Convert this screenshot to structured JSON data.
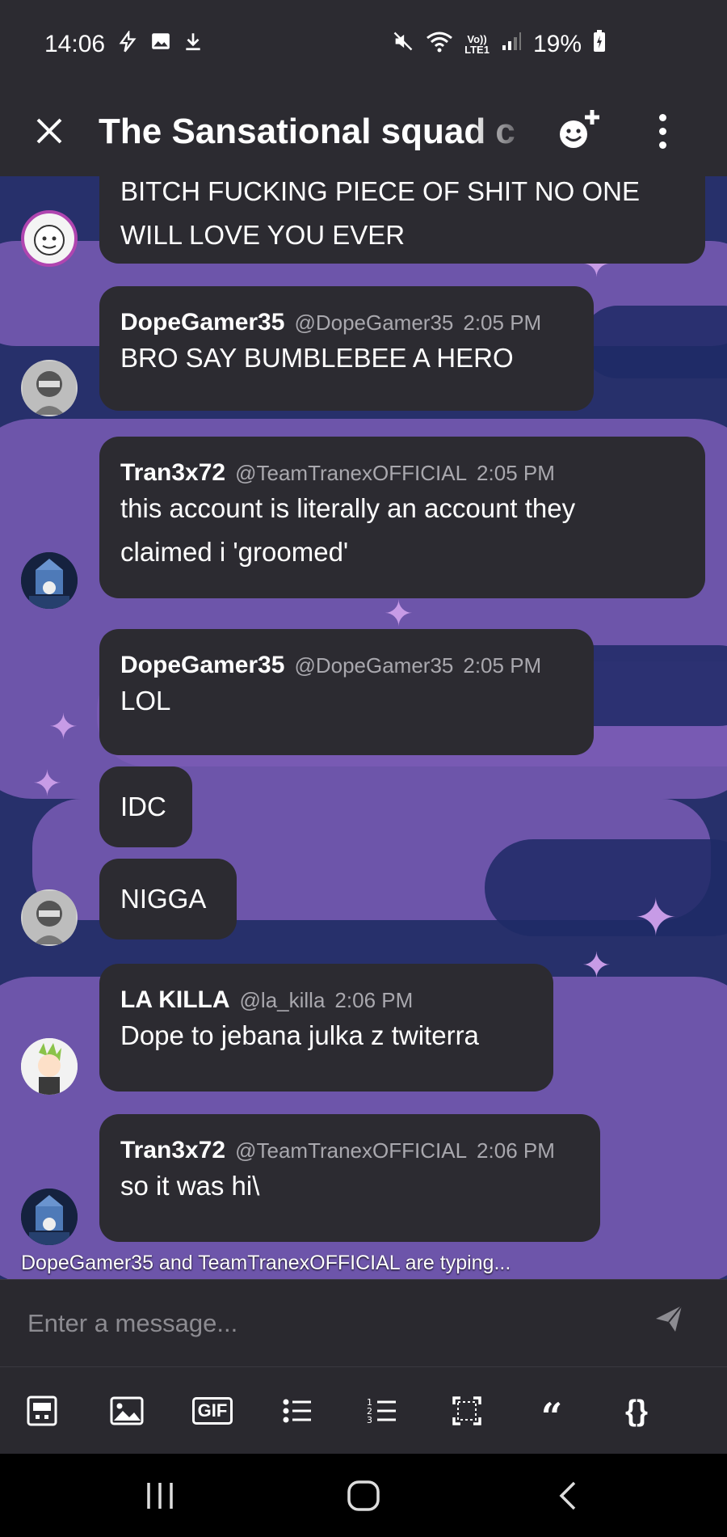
{
  "status_bar": {
    "time": "14:06",
    "battery": "19%",
    "network": "LTE1",
    "network_top": "Vo))",
    "left_icons": [
      "flash-icon",
      "image-icon",
      "download-icon"
    ],
    "right_icons": [
      "mute-icon",
      "wifi-icon",
      "signal-icon",
      "battery-icon"
    ]
  },
  "header": {
    "title": "The Sansational squad c",
    "icons": [
      "close-icon",
      "add-member-icon",
      "more-vert-icon"
    ]
  },
  "messages": [
    {
      "author": "",
      "handle": "",
      "time": "",
      "lines": [
        "BITCH FUCKING PIECE OF SHIT NO ONE",
        "WILL LOVE YOU EVER"
      ]
    },
    {
      "author": "DopeGamer35",
      "handle": "@DopeGamer35",
      "time": "2:05 PM",
      "lines": [
        "BRO SAY BUMBLEBEE A HERO"
      ]
    },
    {
      "author": "Tran3x72",
      "handle": "@TeamTranexOFFICIAL",
      "time": "2:05 PM",
      "lines": [
        "this account is literally an account they",
        "claimed i 'groomed'"
      ]
    },
    {
      "author": "DopeGamer35",
      "handle": "@DopeGamer35",
      "time": "2:05 PM",
      "lines": [
        "LOL"
      ]
    },
    {
      "author": "",
      "handle": "",
      "time": "",
      "lines": [
        "IDC"
      ]
    },
    {
      "author": "",
      "handle": "",
      "time": "",
      "lines": [
        "NIGGA"
      ]
    },
    {
      "author": "LA KILLA",
      "handle": "@la_killa",
      "time": "2:06 PM",
      "lines": [
        "Dope to jebana julka z twiterra"
      ]
    },
    {
      "author": "Tran3x72",
      "handle": "@TeamTranexOFFICIAL",
      "time": "2:06 PM",
      "lines": [
        "so it was hi\\"
      ]
    }
  ],
  "typing_indicator": "DopeGamer35 and TeamTranexOFFICIAL are typing...",
  "composer": {
    "placeholder": "Enter a message...",
    "send_icon": "send-icon"
  },
  "toolbar": {
    "gif_label": "GIF",
    "quote_label": "“",
    "code_label": "{}",
    "icons": [
      "sticker-icon",
      "image-icon",
      "gif-icon",
      "bullet-list-icon",
      "numbered-list-icon",
      "spoiler-icon",
      "quote-icon",
      "code-icon"
    ]
  },
  "nav": {
    "icons": [
      "recents-icon",
      "home-icon",
      "back-icon"
    ]
  },
  "colors": {
    "bubble": "#2c2b31",
    "background": "#27306b",
    "cloud": "#7a5cb5",
    "muted_text": "#a9a8ae"
  }
}
